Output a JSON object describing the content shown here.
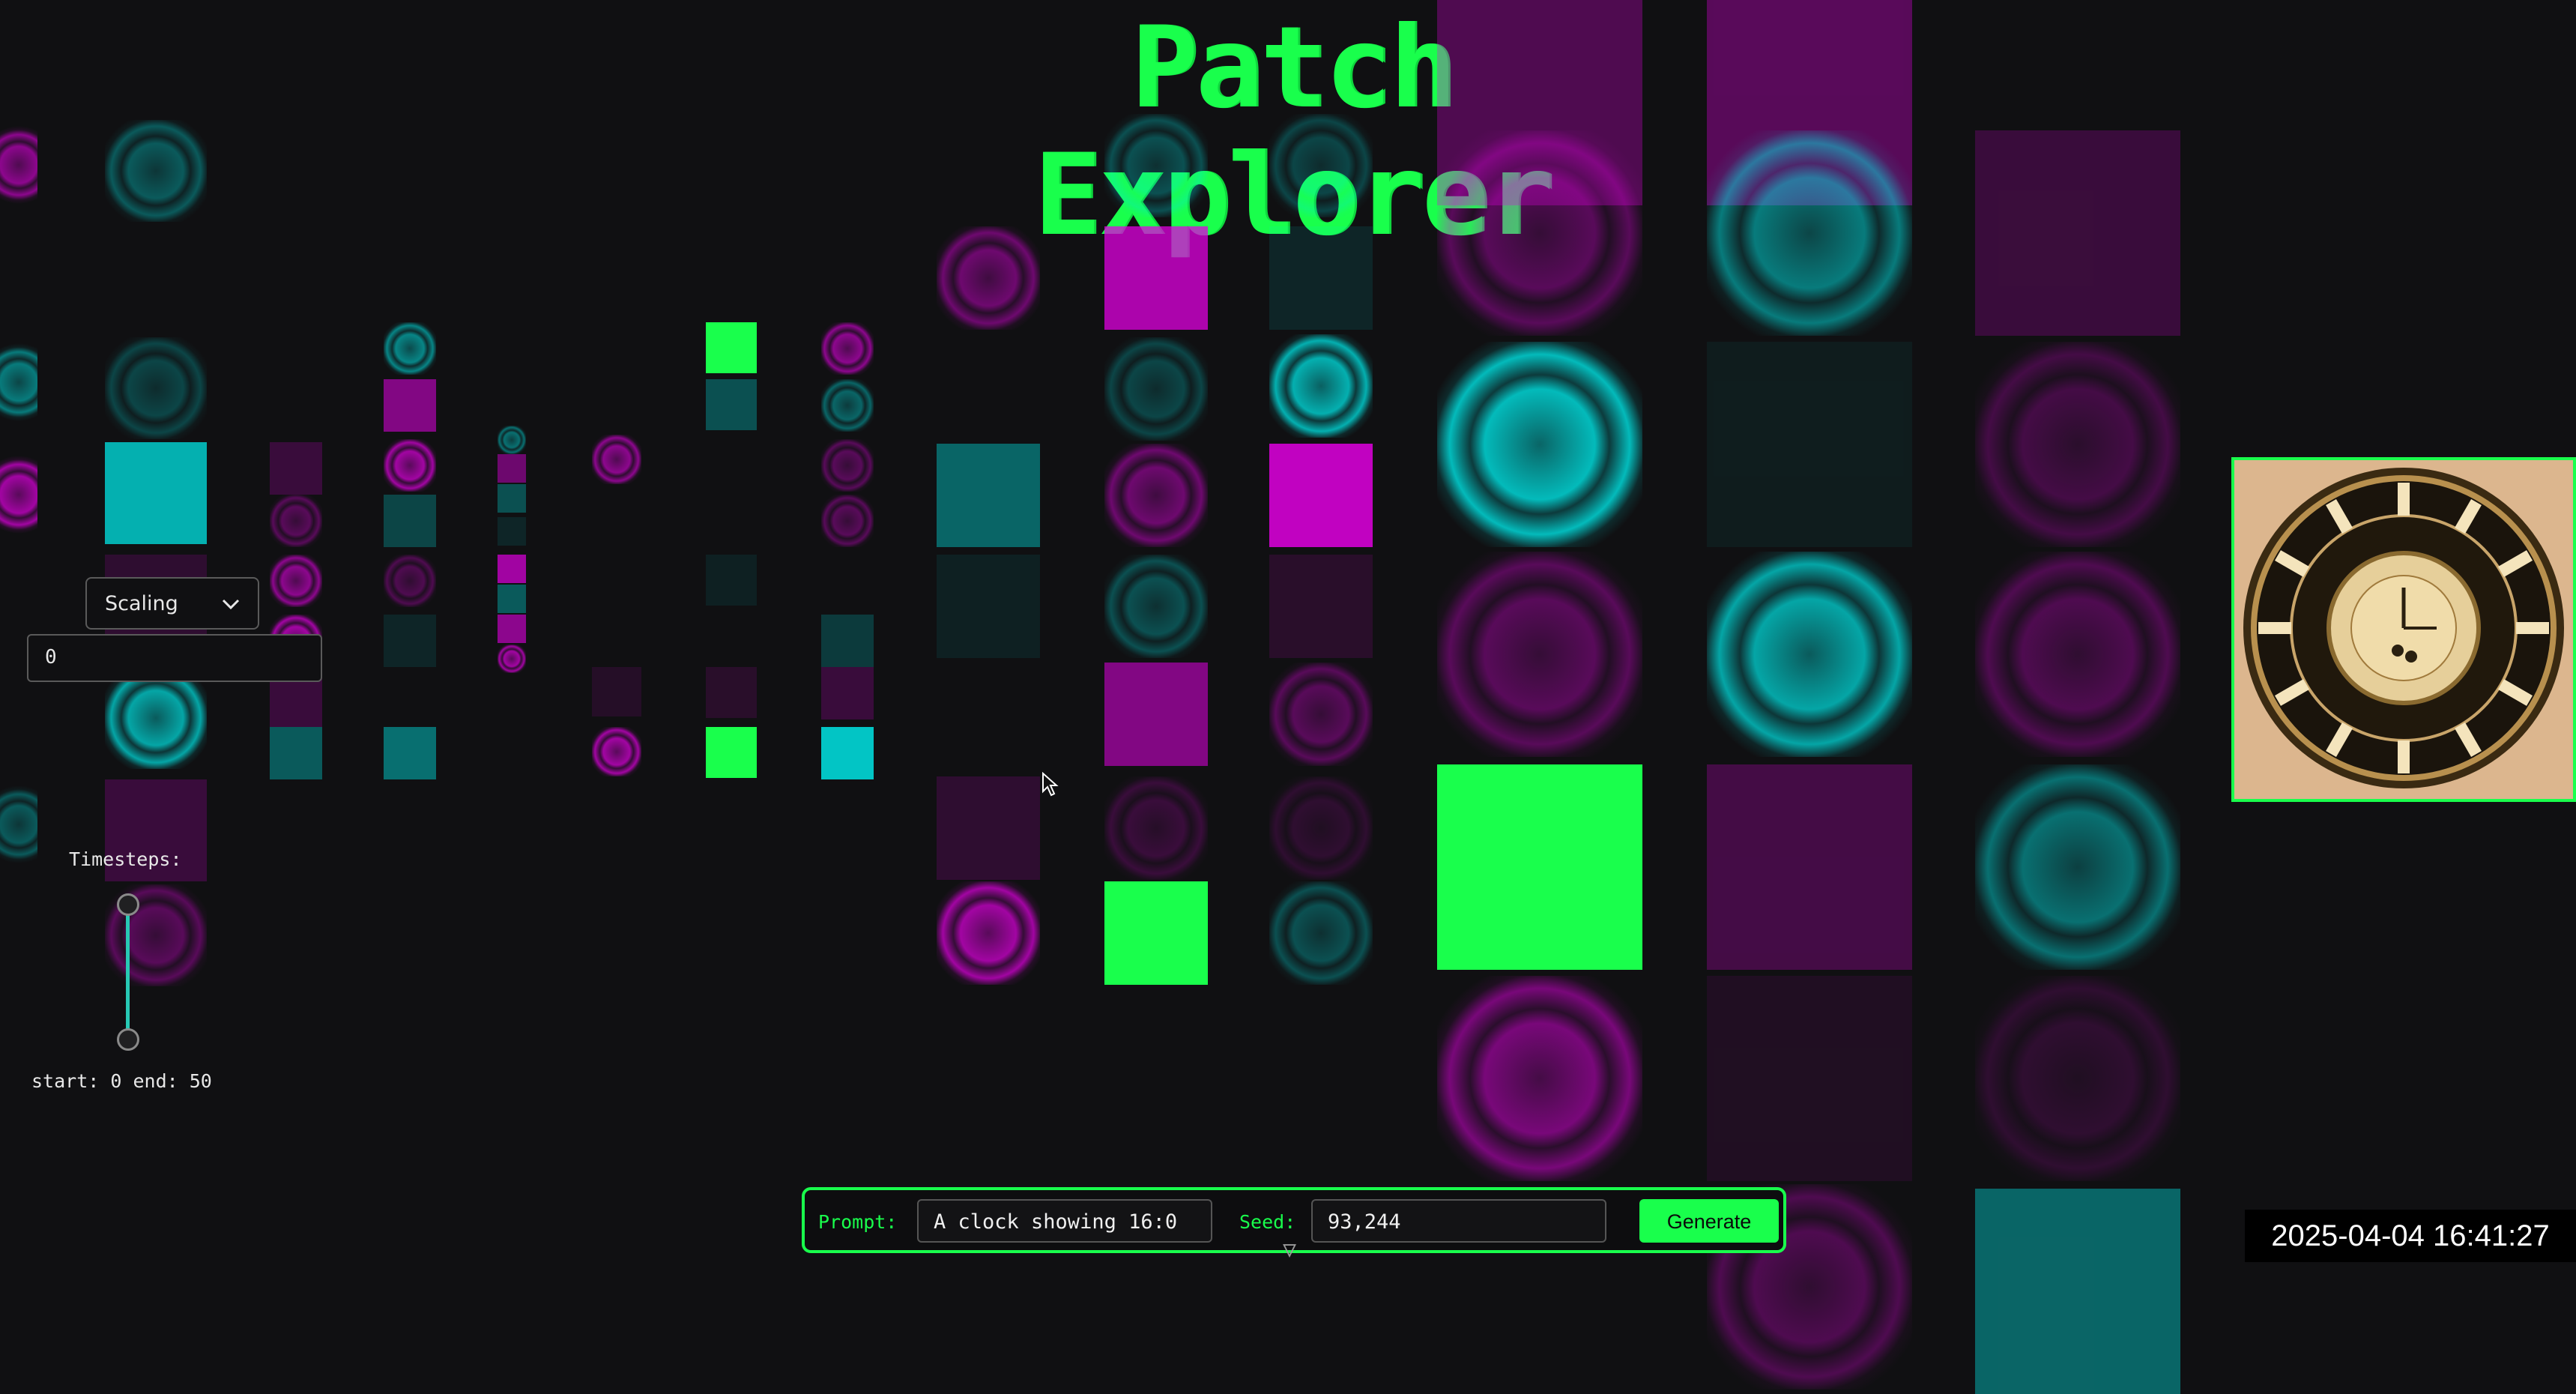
{
  "app": {
    "title": "Patch Explorer"
  },
  "sidebar": {
    "scaling_label": "Scaling",
    "scaling_value": "0",
    "timesteps_label": "Timesteps:",
    "timesteps_range_text": "start: 0 end: 50",
    "timesteps_start": 0,
    "timesteps_end": 50
  },
  "prompt_bar": {
    "prompt_label": "Prompt:",
    "prompt_value": "A clock showing 16:0",
    "seed_label": "Seed:",
    "seed_value": "93,244",
    "generate_label": "Generate"
  },
  "overlay": {
    "timestamp": "2025-04-04  16:41:27"
  },
  "colors": {
    "accent": "#19ff4c",
    "cyan": "#00e5e5",
    "magenta": "#e000e0",
    "background": "#101012"
  },
  "patch_grid": {
    "icon": "clock-patch",
    "output_image": "clock-face"
  }
}
